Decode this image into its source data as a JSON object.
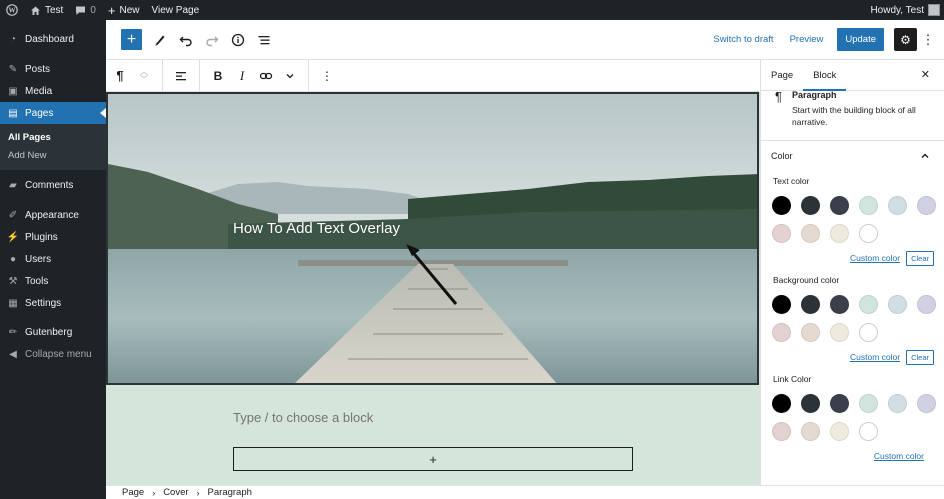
{
  "adminbar": {
    "site_name": "Test",
    "comments_count": "0",
    "new_label": "New",
    "view_label": "View Page",
    "howdy": "Howdy, Test"
  },
  "sidebar": {
    "items": [
      {
        "id": "dashboard",
        "label": "Dashboard",
        "icon": "dashboard-icon"
      },
      {
        "id": "posts",
        "label": "Posts",
        "icon": "pin-icon"
      },
      {
        "id": "media",
        "label": "Media",
        "icon": "media-icon"
      },
      {
        "id": "pages",
        "label": "Pages",
        "icon": "pages-icon"
      },
      {
        "id": "comments",
        "label": "Comments",
        "icon": "comment-icon"
      },
      {
        "id": "appearance",
        "label": "Appearance",
        "icon": "brush-icon"
      },
      {
        "id": "plugins",
        "label": "Plugins",
        "icon": "plugin-icon"
      },
      {
        "id": "users",
        "label": "Users",
        "icon": "user-icon"
      },
      {
        "id": "tools",
        "label": "Tools",
        "icon": "wrench-icon"
      },
      {
        "id": "settings",
        "label": "Settings",
        "icon": "settings-icon"
      },
      {
        "id": "gutenberg",
        "label": "Gutenberg",
        "icon": "pencil-icon"
      }
    ],
    "submenu": [
      "All Pages",
      "Add New"
    ],
    "collapse_label": "Collapse menu"
  },
  "topbar": {
    "switch_draft": "Switch to draft",
    "preview": "Preview",
    "update": "Update"
  },
  "cover": {
    "text": "How To Add Text Overlay"
  },
  "editor": {
    "placeholder": "Type / to choose a block",
    "appender": "+"
  },
  "breadcrumb": [
    "Page",
    "Cover",
    "Paragraph"
  ],
  "settings": {
    "tabs": [
      "Page",
      "Block"
    ],
    "block_title": "Paragraph",
    "block_desc": "Start with the building block of all narrative.",
    "color_panel": "Color",
    "text_color_label": "Text color",
    "background_color_label": "Background color",
    "link_color_label": "Link Color",
    "custom_color": "Custom color",
    "clear": "Clear",
    "palette": [
      "#000000",
      "#2c3338",
      "#3a3f4b",
      "#d1e4dd",
      "#d1dfe4",
      "#d1d1e4",
      "#e4d1d1",
      "#e4dad1",
      "#eeeadd",
      "#ffffff"
    ]
  },
  "colors": {
    "accent": "#2271b1",
    "admin_bg": "#1d2327",
    "canvas_bg": "#d5e5db"
  }
}
